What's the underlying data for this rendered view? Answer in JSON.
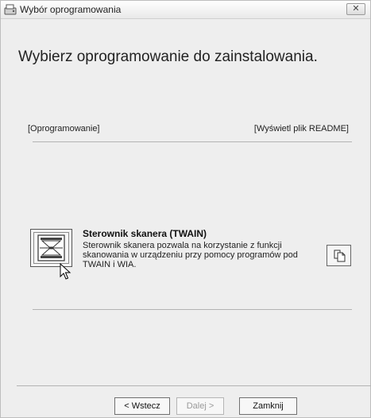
{
  "window": {
    "title": "Wybór oprogramowania",
    "close_label": "✕"
  },
  "main": {
    "heading": "Wybierz oprogramowanie do zainstalowania.",
    "section_label": "[Oprogramowanie]",
    "readme_link": "[Wyświetl plik README]"
  },
  "software": {
    "title": "Sterownik skanera (TWAIN)",
    "description": "Sterownik skanera pozwala na korzystanie z funkcji skanowania w urządzeniu przy pomocy programów pod TWAIN i WIA."
  },
  "buttons": {
    "back": "< Wstecz",
    "next": "Dalej >",
    "close": "Zamknij"
  }
}
